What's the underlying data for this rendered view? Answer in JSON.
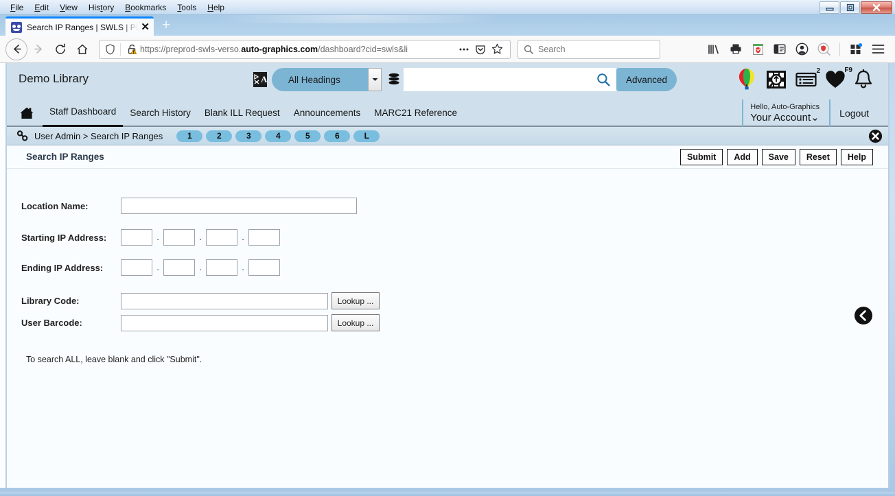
{
  "browser": {
    "menus": [
      {
        "label": "File",
        "mnemonic": "F"
      },
      {
        "label": "Edit",
        "mnemonic": "E"
      },
      {
        "label": "View",
        "mnemonic": "V"
      },
      {
        "label": "History",
        "mnemonic": "t"
      },
      {
        "label": "Bookmarks",
        "mnemonic": "B"
      },
      {
        "label": "Tools",
        "mnemonic": "T"
      },
      {
        "label": "Help",
        "mnemonic": "H"
      }
    ],
    "window_controls": {
      "minimize": "minimize-button",
      "restore": "restore-button",
      "close": "close-button"
    },
    "tab": {
      "title": "Search IP Ranges | SWLS | PLAT",
      "close_label": "✕",
      "favicon": "site-favicon"
    },
    "new_tab_label": "+",
    "url": {
      "prefix": "https://preprod-swls-verso.",
      "domain": "auto-graphics.com",
      "suffix": "/dashboard?cid=swls&li"
    },
    "search": {
      "placeholder": "Search"
    },
    "toolbar_icons": [
      "library-icon",
      "print-icon",
      "pocket-icon",
      "reader-sidebar-icon",
      "account-icon",
      "search-shield-icon",
      "extensions-icon",
      "hamburger-menu-icon"
    ]
  },
  "app": {
    "brand": "Demo Library",
    "search": {
      "scope_label": "All Headings",
      "input_value": "",
      "input_placeholder": "",
      "advanced_label": "Advanced"
    },
    "header_icons": [
      {
        "name": "balloon-icon",
        "badge": ""
      },
      {
        "name": "research-magnifier-icon",
        "badge": ""
      },
      {
        "name": "my-lists-icon",
        "badge": "2"
      },
      {
        "name": "favorites-heart-icon",
        "badge": "F9"
      },
      {
        "name": "notifications-bell-icon",
        "badge": ""
      }
    ],
    "nav": [
      {
        "label": "Staff Dashboard",
        "active": true
      },
      {
        "label": "Search History",
        "active": false
      },
      {
        "label": "Blank ILL Request",
        "active": false
      },
      {
        "label": "Announcements",
        "active": false
      },
      {
        "label": "MARC21 Reference",
        "active": false
      }
    ],
    "account": {
      "hello": "Hello, Auto-Graphics",
      "your_account": "Your Account",
      "chevron": "⌄",
      "logout": "Logout"
    },
    "breadcrumb": {
      "text": "User Admin > Search IP Ranges",
      "pager": [
        "1",
        "2",
        "3",
        "4",
        "5",
        "6",
        "L"
      ],
      "close_label": "✕"
    }
  },
  "page": {
    "title": "Search IP Ranges",
    "action_buttons": [
      "Submit",
      "Add",
      "Save",
      "Reset",
      "Help"
    ],
    "fields": {
      "location_name": {
        "label": "Location Name:",
        "value": ""
      },
      "starting_ip": {
        "label": "Starting IP Address:",
        "octets": [
          "",
          "",
          "",
          ""
        ],
        "separator": "."
      },
      "ending_ip": {
        "label": "Ending IP Address:",
        "octets": [
          "",
          "",
          "",
          ""
        ],
        "separator": "."
      },
      "library_code": {
        "label": "Library Code:",
        "value": "",
        "lookup_label": "Lookup ..."
      },
      "user_barcode": {
        "label": "User Barcode:",
        "value": "",
        "lookup_label": "Lookup ..."
      }
    },
    "hint": "To search ALL, leave blank and click \"Submit\".",
    "back_button": "back-circle-button"
  },
  "colors": {
    "header_blue": "#cfe0ec",
    "accent_blue": "#7cb4d4",
    "pager_blue": "#79bede",
    "content_bg": "#fafdff",
    "tab_accent": "#0a84ff",
    "close_red": "#c75445"
  }
}
